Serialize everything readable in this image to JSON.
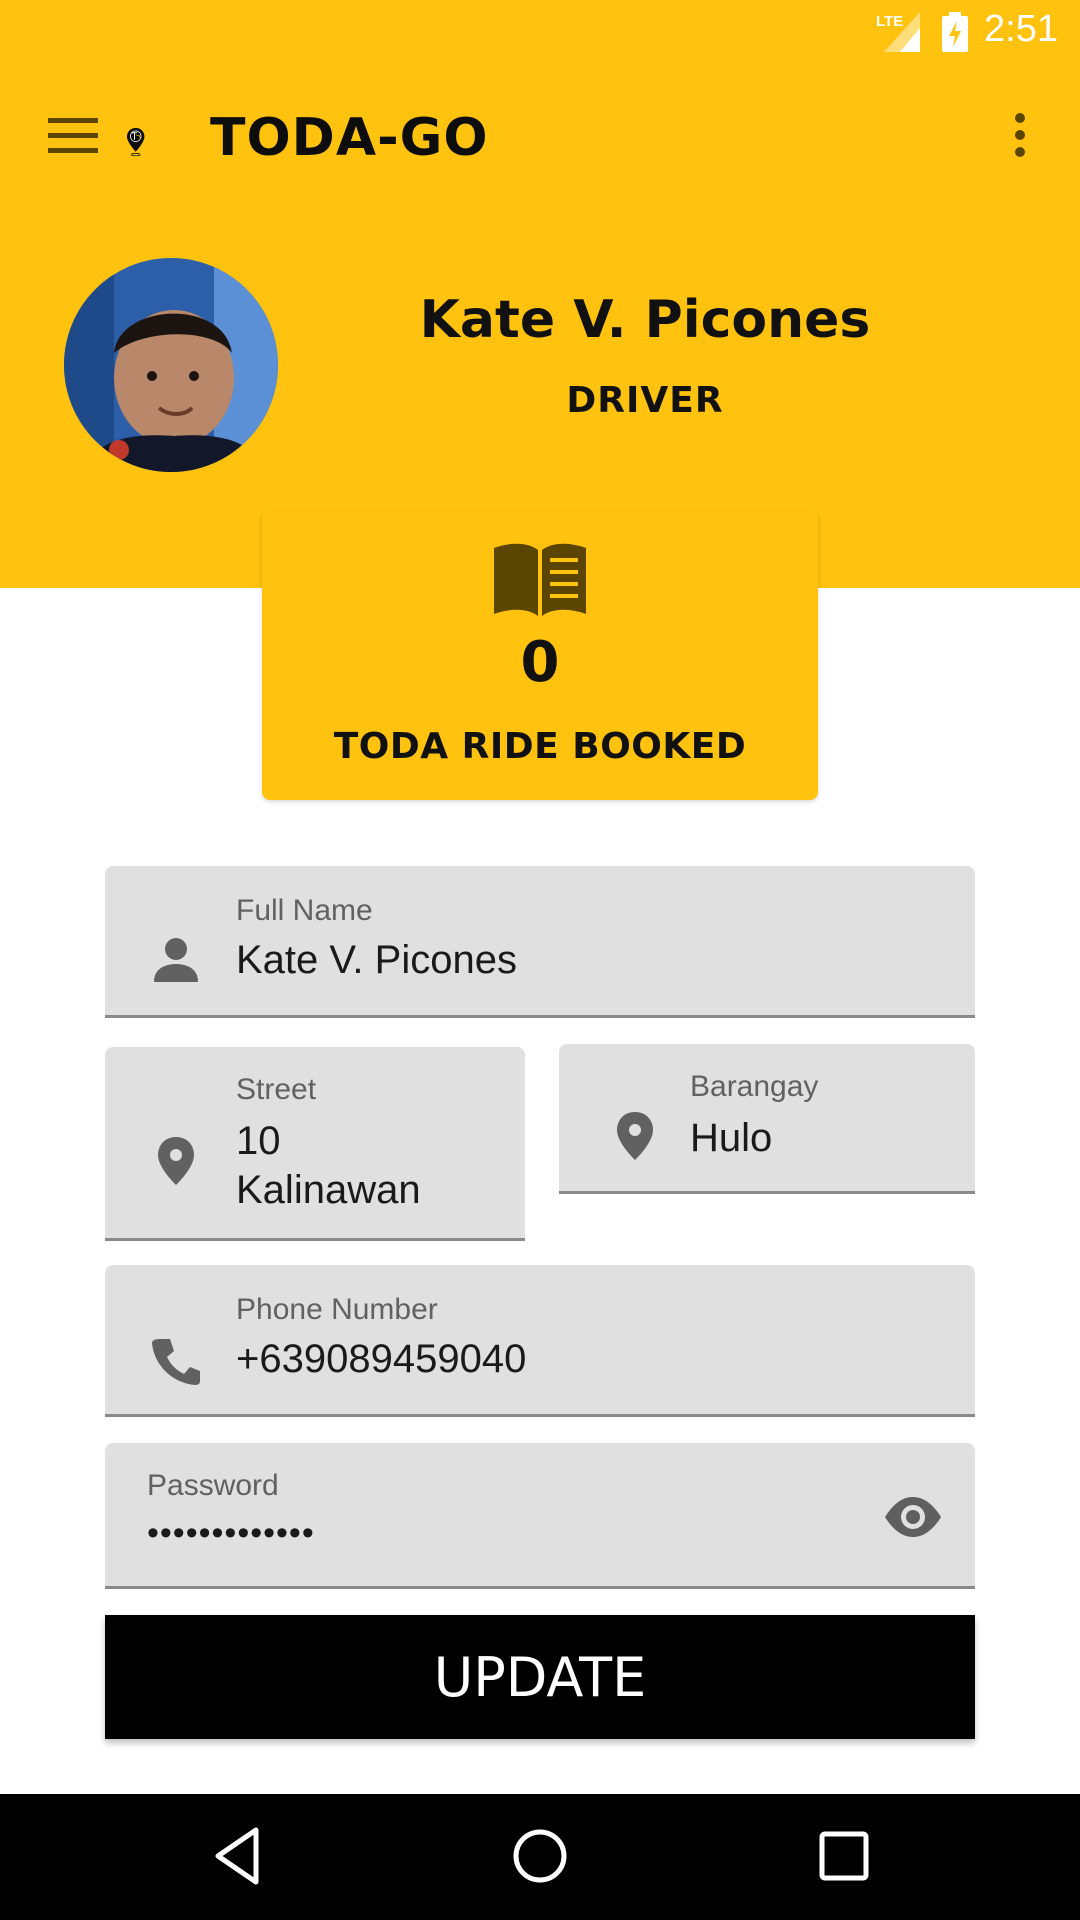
{
  "status_bar": {
    "time": "2:51",
    "network": "LTE"
  },
  "toolbar": {
    "app_name": "TODA-GO"
  },
  "profile": {
    "name": "Kate V. Picones",
    "role": "DRIVER"
  },
  "stats": {
    "count": "0",
    "label": "TODA RIDE BOOKED"
  },
  "form": {
    "full_name": {
      "label": "Full Name",
      "value": "Kate V. Picones",
      "icon": "person-icon"
    },
    "street": {
      "label": "Street",
      "value_line1": "10",
      "value_line2": "Kalinawan",
      "icon": "location-pin-icon"
    },
    "barangay": {
      "label": "Barangay",
      "value": "Hulo",
      "icon": "location-pin-icon"
    },
    "phone": {
      "label": "Phone Number",
      "value": "+639089459040",
      "icon": "phone-icon"
    },
    "password": {
      "label": "Password",
      "value": "•••••••••••••",
      "icon": "eye-icon"
    }
  },
  "update_button": {
    "label": "UPDATE"
  },
  "colors": {
    "brand_yellow": "#FEC20F",
    "field_bg": "#E0E0E0",
    "button_bg": "#000000"
  }
}
